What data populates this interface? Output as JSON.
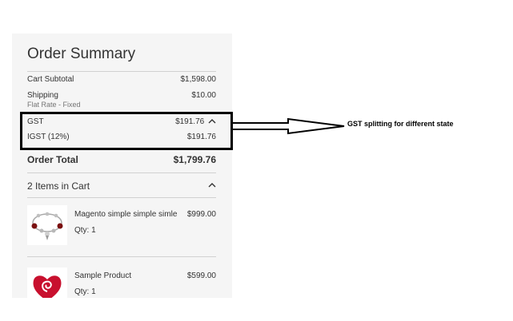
{
  "summary": {
    "title": "Order Summary",
    "subtotal": {
      "label": "Cart Subtotal",
      "value": "$1,598.00"
    },
    "shipping": {
      "label": "Shipping",
      "value": "$10.00",
      "method": "Flat Rate - Fixed"
    },
    "gst": {
      "label": "GST",
      "value": "$191.76"
    },
    "igst": {
      "label": "IGST (12%)",
      "value": "$191.76"
    },
    "total": {
      "label": "Order Total",
      "value": "$1,799.76"
    }
  },
  "cart": {
    "heading": "2 Items in Cart",
    "items": [
      {
        "name": "Magento simple simple simle",
        "price": "$999.00",
        "qty": "Qty: 1",
        "thumb_icon": "bracelet-icon"
      },
      {
        "name": "Sample Product",
        "price": "$599.00",
        "qty": "Qty: 1",
        "thumb_icon": "swirl-heart-icon"
      }
    ]
  },
  "annotation": {
    "text": "GST splitting for different state"
  },
  "colors": {
    "panel_bg": "#f5f5f5",
    "separator": "#d1d1d1",
    "text": "#333333",
    "muted": "#757575",
    "highlight_border": "#000000",
    "product_red": "#c8102e"
  }
}
